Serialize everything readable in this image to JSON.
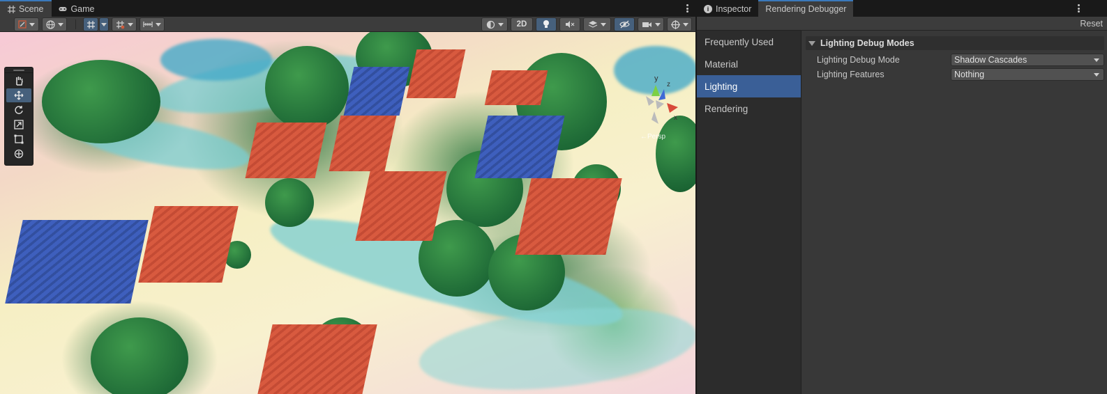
{
  "scene_window": {
    "tabs": [
      {
        "label": "Scene",
        "icon": "grid-icon",
        "active": true
      },
      {
        "label": "Game",
        "icon": "gamepad-icon",
        "active": false
      }
    ],
    "toolbar": {
      "twod_label": "2D"
    },
    "gizmo": {
      "y_label": "y",
      "x_label": "x",
      "z_label": "z",
      "projection_label": "←Persp"
    },
    "scene_tools": [
      "hand-tool",
      "move-tool",
      "rotate-tool",
      "scale-tool",
      "rect-tool",
      "transform-tool"
    ],
    "active_tool": "move-tool"
  },
  "right_window": {
    "tabs": [
      {
        "label": "Inspector",
        "icon": "info-icon",
        "active": false
      },
      {
        "label": "Rendering Debugger",
        "active": true
      }
    ],
    "reset_label": "Reset",
    "categories": [
      {
        "label": "Frequently Used",
        "selected": false
      },
      {
        "label": "Material",
        "selected": false
      },
      {
        "label": "Lighting",
        "selected": true
      },
      {
        "label": "Rendering",
        "selected": false
      }
    ],
    "section": {
      "title": "Lighting Debug Modes",
      "fields": [
        {
          "label": "Lighting Debug Mode",
          "value": "Shadow Cascades"
        },
        {
          "label": "Lighting Features",
          "value": "Nothing"
        }
      ]
    }
  },
  "colors": {
    "accent_tab": "#3a79bb",
    "selected_category": "#3a5f97",
    "toggle_on": "#46607c"
  }
}
